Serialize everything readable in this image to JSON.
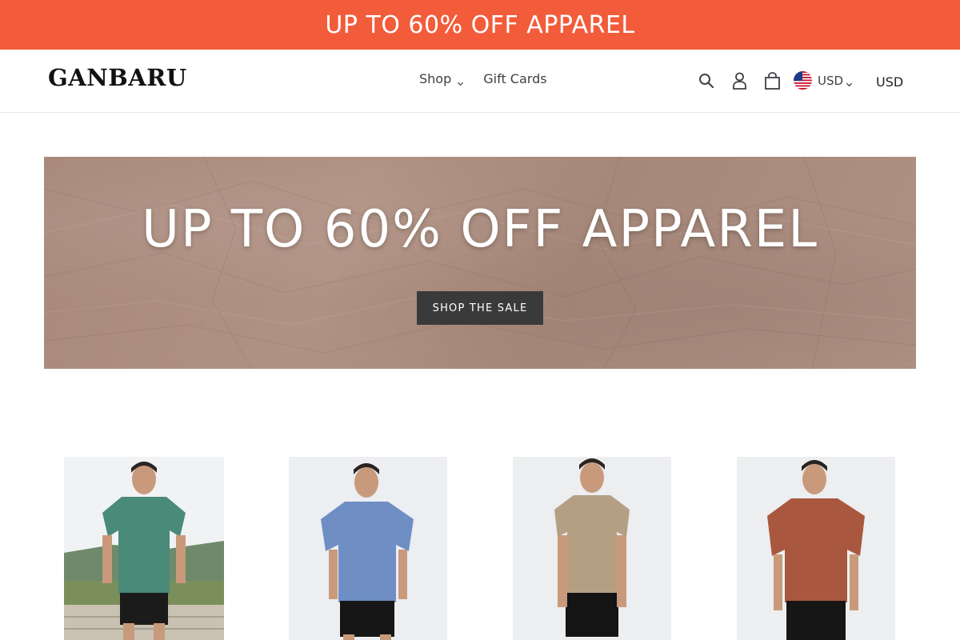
{
  "announcement": {
    "text": "UP TO 60% OFF APPAREL"
  },
  "header": {
    "logo": "GANBARU",
    "nav": [
      {
        "label": "Shop",
        "has_dropdown": true
      },
      {
        "label": "Gift Cards",
        "has_dropdown": false
      }
    ],
    "icons": [
      "search-icon",
      "account-icon",
      "cart-icon"
    ],
    "currency_selector": {
      "value": "USD",
      "flag": "us-flag-icon"
    },
    "currency_label": "USD"
  },
  "hero": {
    "heading": "UP TO 60% OFF APPAREL",
    "button_label": "SHOP THE SALE",
    "background_color": "#a88a7c"
  },
  "products": [
    {
      "shirt_color": "#4a8a78",
      "background": "outdoor"
    },
    {
      "shirt_color": "#6f8fc4",
      "background": "studio"
    },
    {
      "shirt_color": "#b49f83",
      "background": "studio"
    },
    {
      "shirt_color": "#a9583f",
      "background": "studio"
    }
  ],
  "colors": {
    "announcement_bg": "#f25c3b",
    "button_bg": "#3a3a3a",
    "text": "#3d4246"
  }
}
